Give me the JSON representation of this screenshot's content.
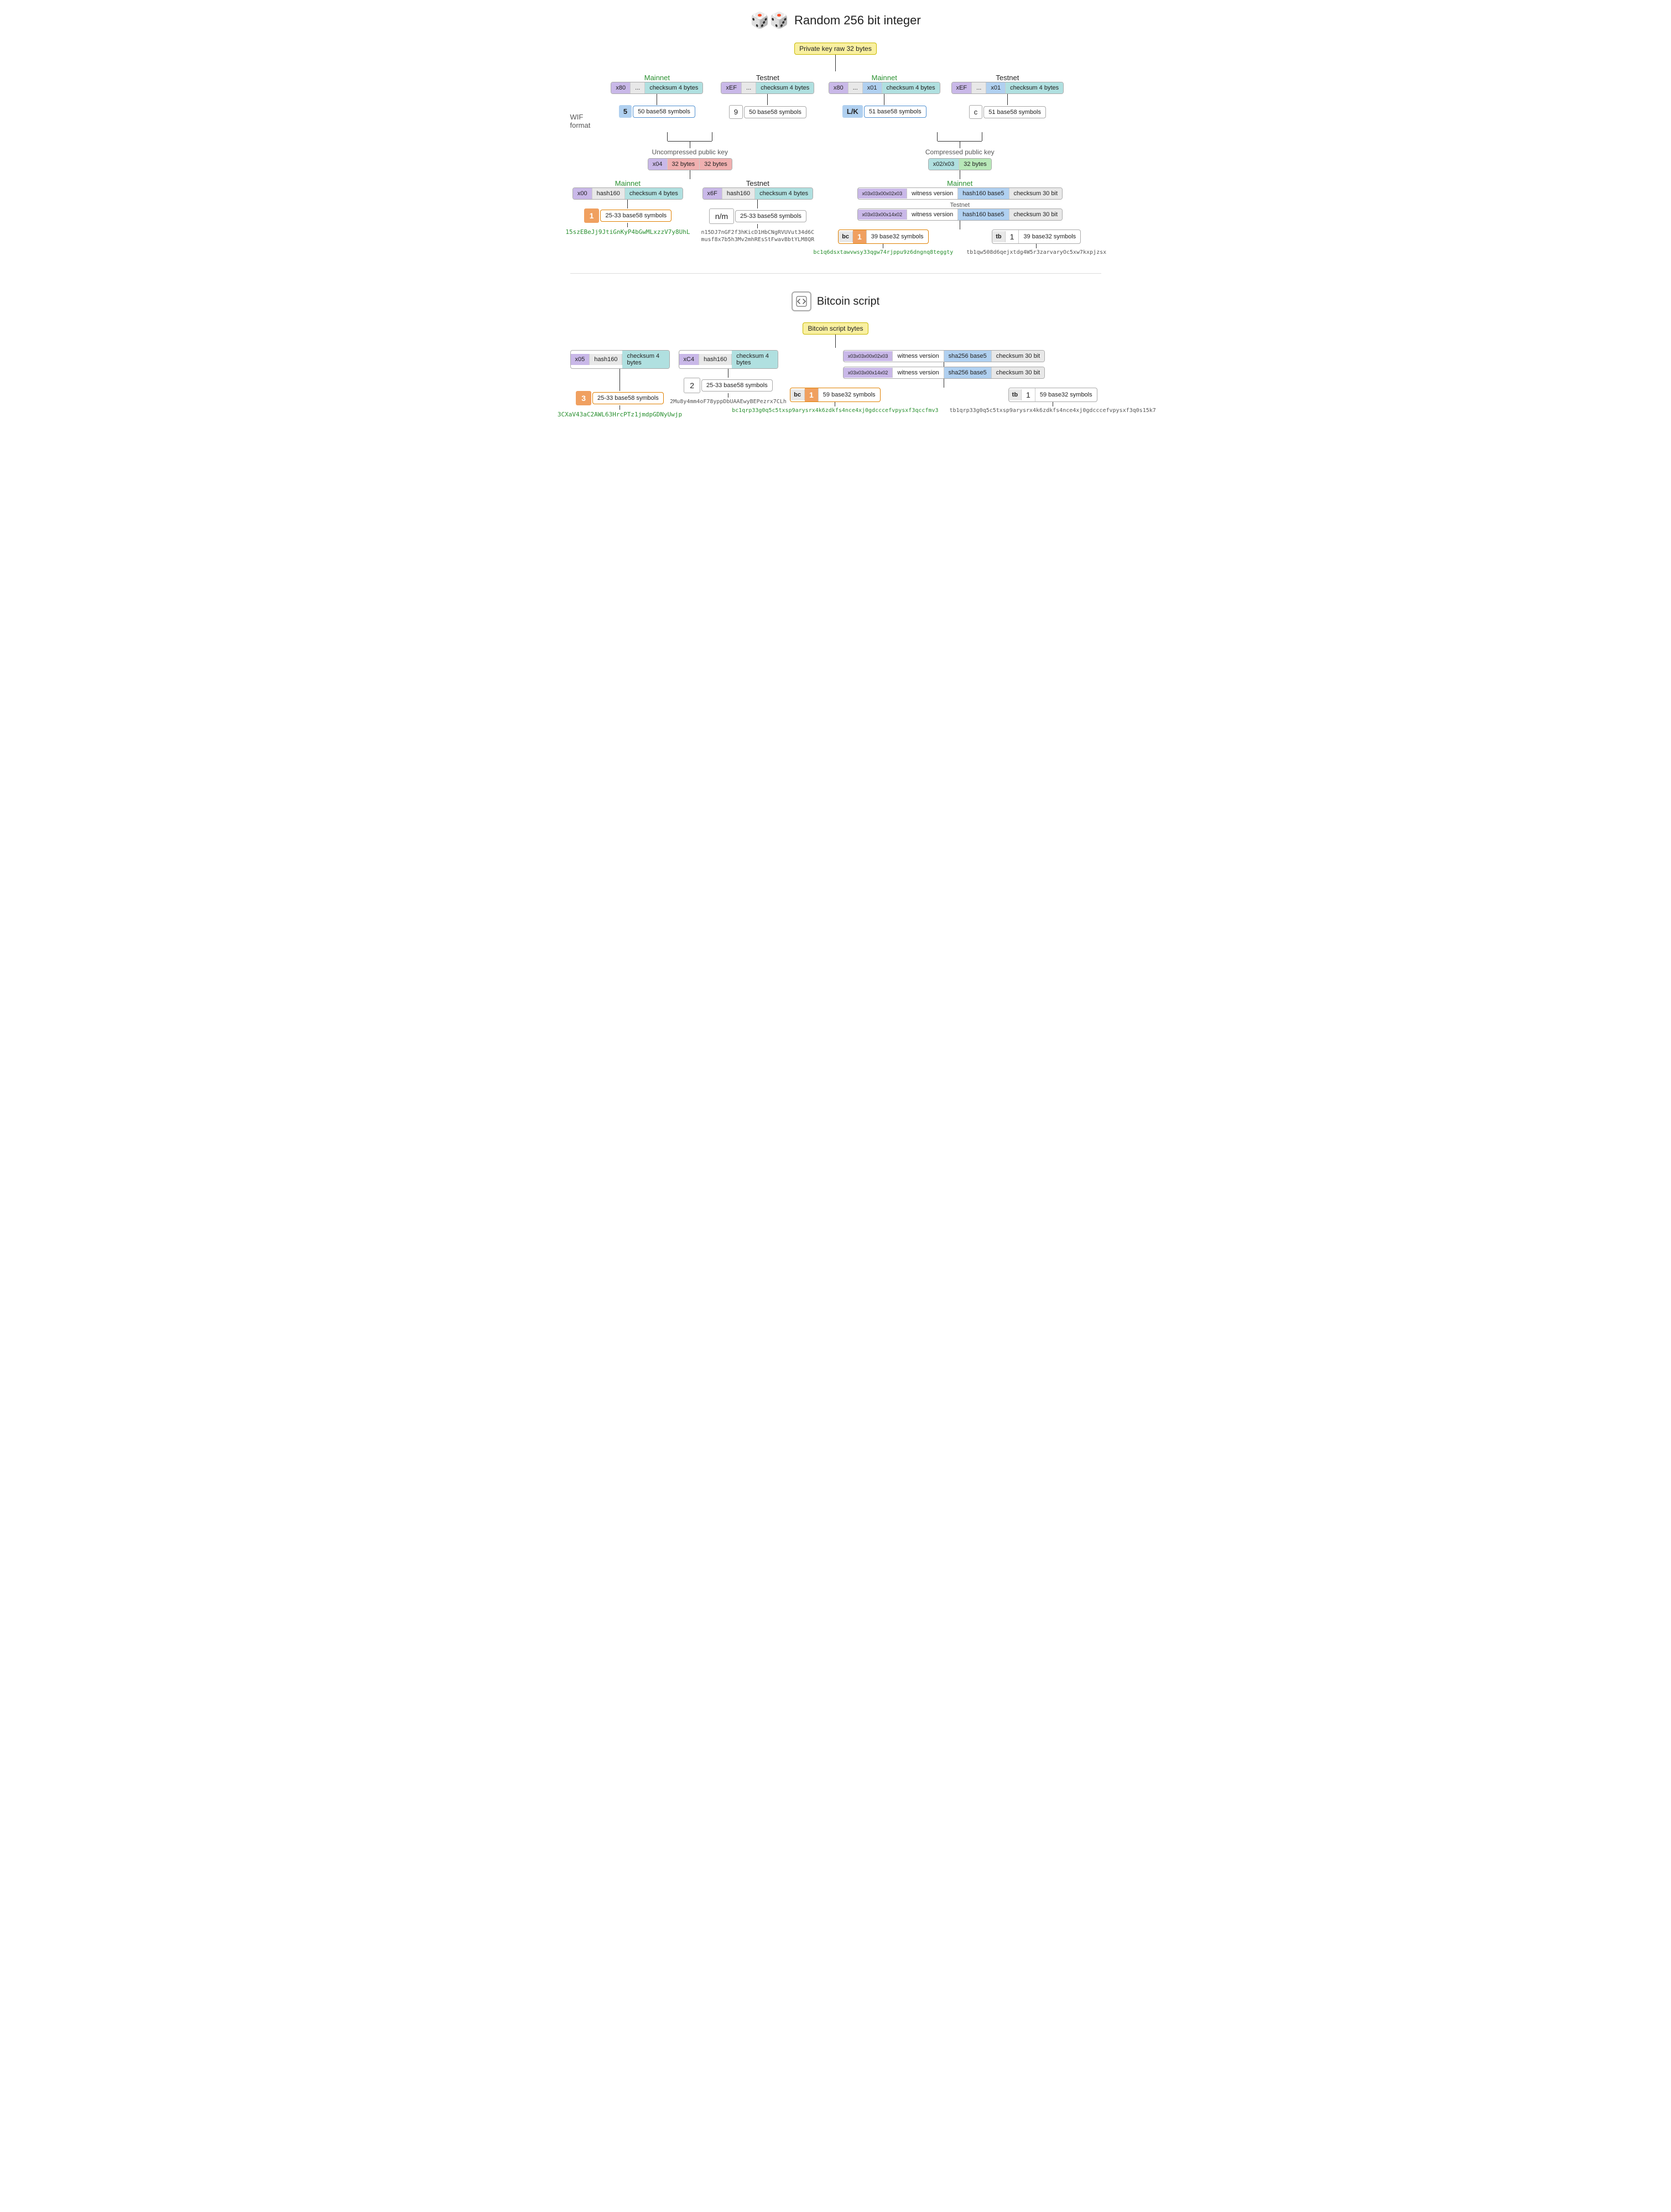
{
  "header": {
    "title": "Random 256 bit integer",
    "dice_icon": "🎲"
  },
  "section1": {
    "root_label": "Private key raw 32 bytes",
    "columns": [
      {
        "network_label": "Mainnet",
        "network_color": "green",
        "bytes_row": [
          "x80",
          "...",
          "checksum 4 bytes"
        ],
        "bytes_colors": [
          "purple",
          "gray",
          "teal"
        ],
        "wif_prefix": "5",
        "wif_desc": "50 base58 symbols",
        "wif_prefix_color": "blue"
      },
      {
        "network_label": "Testnet",
        "network_color": "black",
        "bytes_row": [
          "xEF",
          "...",
          "checksum 4 bytes"
        ],
        "bytes_colors": [
          "purple",
          "gray",
          "teal"
        ],
        "wif_prefix": "9",
        "wif_desc": "50 base58 symbols",
        "wif_prefix_color": "white"
      },
      {
        "network_label": "Mainnet",
        "network_color": "green",
        "bytes_row": [
          "x80",
          "...",
          "x01",
          "checksum 4 bytes"
        ],
        "bytes_colors": [
          "purple",
          "gray",
          "blue",
          "teal"
        ],
        "wif_prefix": "L/K",
        "wif_desc": "51 base58 symbols",
        "wif_prefix_color": "blue"
      },
      {
        "network_label": "Testnet",
        "network_color": "black",
        "bytes_row": [
          "xEF",
          "...",
          "x01",
          "checksum 4 bytes"
        ],
        "bytes_colors": [
          "purple",
          "gray",
          "blue",
          "teal"
        ],
        "wif_prefix": "c",
        "wif_desc": "51 base58 symbols",
        "wif_prefix_color": "white"
      }
    ],
    "wif_format_label": "WIF\nformat"
  },
  "section2": {
    "uncompressed_label": "Uncompressed public key",
    "uncompressed_bytes": [
      "x04",
      "32 bytes",
      "32 bytes"
    ],
    "uncompressed_colors": [
      "purple",
      "pink",
      "pink"
    ],
    "compressed_label": "Compressed public key",
    "compressed_bytes": [
      "x02/x03",
      "32 bytes"
    ],
    "compressed_colors": [
      "teal",
      "green"
    ],
    "mainnet_label": "Mainnet",
    "testnet_label": "Testnet",
    "uncompressed_mainnet": [
      "x00",
      "hash160",
      "checksum 4 bytes"
    ],
    "uncompressed_mainnet_colors": [
      "purple",
      "gray",
      "teal"
    ],
    "uncompressed_testnet": [
      "x6F",
      "hash160",
      "checksum 4 bytes"
    ],
    "uncompressed_testnet_colors": [
      "purple",
      "gray",
      "teal"
    ],
    "p2pkh_mainnet_prefix": "1",
    "p2pkh_mainnet_desc": "25-33 base58 symbols",
    "p2pkh_mainnet_address": "15szEBeJj9JtiGnKyP4bGwMLxzzV7y8UhL",
    "p2pkh_testnet_prefix": "n/m",
    "p2pkh_testnet_desc": "25-33 base58 symbols",
    "p2pkh_testnet_address1": "n15DJ7nGF2f3hKicD1HbCNgRVUVut34d6C",
    "p2pkh_testnet_address2": "musf8x7b5h3Mv2mhREsStFwavBbtYLM8QR",
    "compressed_mainnet_label": "Mainnet",
    "compressed_mainnet_bytes": [
      "x03x03x00x02x03",
      "witness version",
      "hash160 base5",
      "checksum 30 bit"
    ],
    "compressed_testnet_bytes": [
      "x03x03x00x14x02",
      "witness version",
      "hash160 base5",
      "checksum 30 bit"
    ],
    "bech32_mainnet_prefix": "bc",
    "bech32_mainnet_one": "1",
    "bech32_mainnet_desc": "39 base32 symbols",
    "bech32_mainnet_address": "bc1q6dsxtawvwsy33qgw74rjppu9z6dngnq8teggty",
    "bech32_testnet_prefix": "tb",
    "bech32_testnet_one": "1",
    "bech32_testnet_desc": "39 base32 symbols",
    "bech32_testnet_address": "tb1qw508d6qejxtdg4W5r3zarvaryOc5xw7kxpjzsx"
  },
  "section3": {
    "script_icon": "</>",
    "script_title": "Bitcoin script",
    "root_label": "Bitcoin script bytes",
    "left_col": {
      "bytes": [
        "x05",
        "hash160",
        "checksum 4 bytes"
      ],
      "bytes_colors": [
        "purple",
        "gray",
        "teal"
      ],
      "prefix": "3",
      "desc": "25-33 base58 symbols",
      "address": "3CXaV43aC2AWL63HrcPTz1jmdpGDNyUwjp"
    },
    "mid_col": {
      "bytes": [
        "xC4",
        "hash160",
        "checksum 4 bytes"
      ],
      "bytes_colors": [
        "purple",
        "gray",
        "teal"
      ],
      "prefix": "2",
      "desc": "25-33 base58 symbols",
      "address": "2Mu8y4mm4oF78yppDbUAAEwyBEPezrx7CLh"
    },
    "right_col": {
      "mainnet_bytes": [
        "x03x03x00x02x03",
        "witness version",
        "sha256 base5",
        "checksum 30 bit"
      ],
      "testnet_bytes": [
        "x03x03x00x14x02",
        "witness version",
        "sha256 base5",
        "checksum 30 bit"
      ],
      "bech32_mainnet_prefix": "bc",
      "bech32_mainnet_one": "1",
      "bech32_mainnet_desc": "59 base32 symbols",
      "bech32_mainnet_address": "bc1qrp33g0q5c5txsp9arysrx4k6zdkfs4nce4xj0gdcccefvpysxf3qccfmv3",
      "bech32_testnet_prefix": "tb",
      "bech32_testnet_one": "1",
      "bech32_testnet_desc": "59 base32 symbols",
      "bech32_testnet_address": "tb1qrp33g0q5c5txsp9arysrx4k6zdkfs4nce4xj0gdcccefvpysxf3q0s15k7"
    }
  }
}
